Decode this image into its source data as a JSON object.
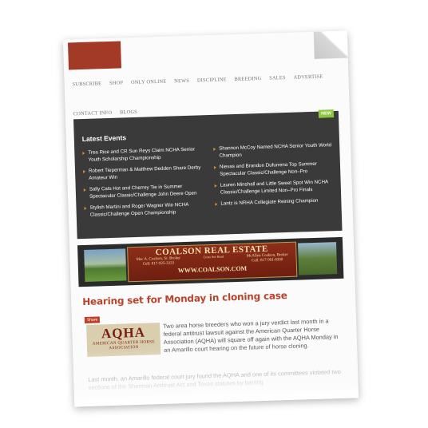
{
  "nav": {
    "row1": [
      "SUBSCRIBE",
      "SHOP",
      "ONLY ONLINE",
      "NEWS",
      "DISCIPLINE",
      "BREEDING",
      "SALES",
      "ADVERTISE"
    ],
    "row2": [
      "CONTACT INFO",
      "BLOGS"
    ]
  },
  "events": {
    "title": "Latest Events",
    "badge": "NEW",
    "left": [
      "Trea Rice and CR Sun Reys Claim NCHA Senior Youth Scholarship Championship",
      "Robert Tieperman & Matthew Dedden Share Derby Amateur Win",
      "Sally Cats Hot and Cherrey Tie in Summer Spectacular Classic/Challenge John Deere Open",
      "Stylish Martini and Roger Wagner Win NCHA Classic/Challenge Open Championship"
    ],
    "right": [
      "Shannon McCoy Named NCHA Senior Youth World Champion",
      "Nievas and Brandon Dufurrena Top Summer Spectacular Classic/Challenge Non–Pro",
      "Lauren Minshall and Little Sweet Spot Win NCHA Classic/Challenge Limited Non–Pro Finals",
      "Lantz is NRHA Collegiate Reining Champion"
    ]
  },
  "banner": {
    "title": "COALSON REAL ESTATE",
    "broker_left": "Mac A. Coalson, Sr. Broker",
    "phone_left": "Cell: 817-925-3333",
    "broker_right": "McAllen Coalson, Broker",
    "phone_right": "Cell: 817-991-8300",
    "middle": "Cross Are Road",
    "url": "WWW.COALSON.COM"
  },
  "article": {
    "headline": "Hearing set for Monday in cloning case",
    "share_label": "Share",
    "logo_big": "AQHA",
    "logo_small": "AMERICAN QUARTER HORSE ASSOCIATION",
    "p1": "Two area horse breeders who won a jury verdict last month in a federal antitrust lawsuit against the American Quarter Horse Association (AQHA) will square off again with the AQHA Monday in an Amarillo court hearing on the future of horse cloning.",
    "p2": "Last month, an Amarillo federal court jury found the AQHA and one of its committees violated two sections of the Sherman Antitrust Act and Texas statutes by barring"
  },
  "colors": {
    "accent": "#b8442c",
    "logo_block": "#a23a27",
    "events_bg": "#3a3a3a",
    "bullet": "#e08a2c",
    "new_badge": "#8cc63f"
  }
}
